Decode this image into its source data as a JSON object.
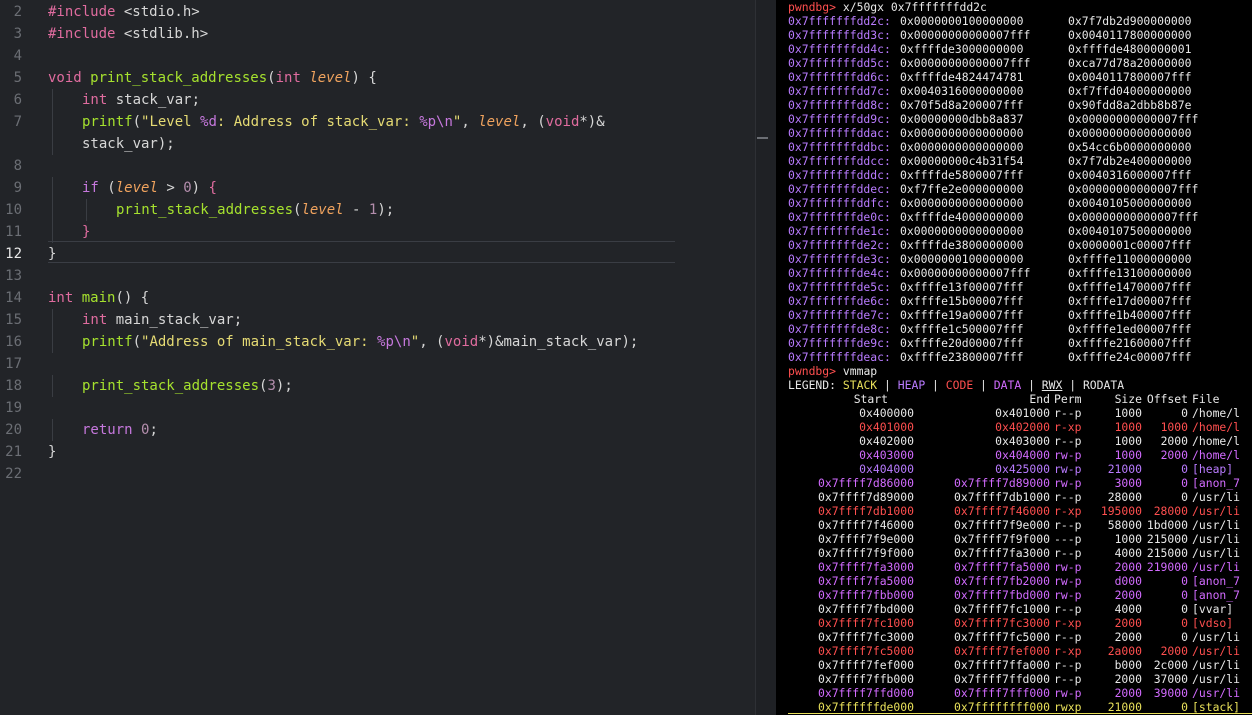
{
  "editor": {
    "lines": [
      {
        "n": "2",
        "tokens": [
          [
            "kw-pp",
            "#include "
          ],
          [
            "hdr",
            "<stdio.h>"
          ]
        ]
      },
      {
        "n": "3",
        "tokens": [
          [
            "kw-pp",
            "#include "
          ],
          [
            "hdr",
            "<stdlib.h>"
          ]
        ]
      },
      {
        "n": "4",
        "tokens": []
      },
      {
        "n": "5",
        "tokens": [
          [
            "typ",
            "void "
          ],
          [
            "fn",
            "print_stack_addresses"
          ],
          [
            "punc",
            "("
          ],
          [
            "typ",
            "int "
          ],
          [
            "param",
            "level"
          ],
          [
            "punc",
            ") {"
          ]
        ]
      },
      {
        "n": "6",
        "indent": 1,
        "tokens": [
          [
            "typ",
            "int "
          ],
          [
            "punc",
            "stack_var;"
          ]
        ]
      },
      {
        "n": "7",
        "indent": 1,
        "tokens": [
          [
            "fn",
            "printf"
          ],
          [
            "punc",
            "("
          ],
          [
            "str",
            "\"Level "
          ],
          [
            "esc",
            "%d"
          ],
          [
            "str",
            ": Address of stack_var: "
          ],
          [
            "esc",
            "%p\\n"
          ],
          [
            "str",
            "\""
          ],
          [
            "punc",
            ", "
          ],
          [
            "param",
            "level"
          ],
          [
            "punc",
            ", ("
          ],
          [
            "typ",
            "void"
          ],
          [
            "punc",
            "*)&"
          ]
        ]
      },
      {
        "n": "",
        "indent": 1,
        "tokens": [
          [
            "punc",
            "stack_var);"
          ]
        ]
      },
      {
        "n": "8",
        "tokens": []
      },
      {
        "n": "9",
        "indent": 1,
        "tokens": [
          [
            "kw",
            "if "
          ],
          [
            "punc",
            "("
          ],
          [
            "param",
            "level"
          ],
          [
            "punc",
            " > "
          ],
          [
            "num",
            "0"
          ],
          [
            "punc",
            ") "
          ],
          [
            "kw-pp",
            "{"
          ]
        ]
      },
      {
        "n": "10",
        "indent": 2,
        "tokens": [
          [
            "fn",
            "print_stack_addresses"
          ],
          [
            "punc",
            "("
          ],
          [
            "param",
            "level"
          ],
          [
            "punc",
            " - "
          ],
          [
            "num",
            "1"
          ],
          [
            "punc",
            ");"
          ]
        ]
      },
      {
        "n": "11",
        "indent": 1,
        "tokens": [
          [
            "kw-pp",
            "}"
          ]
        ]
      },
      {
        "n": "12",
        "active": true,
        "tokens": [
          [
            "punc",
            "}"
          ]
        ]
      },
      {
        "n": "13",
        "tokens": []
      },
      {
        "n": "14",
        "tokens": [
          [
            "typ",
            "int "
          ],
          [
            "fn",
            "main"
          ],
          [
            "punc",
            "() {"
          ]
        ]
      },
      {
        "n": "15",
        "indent": 1,
        "tokens": [
          [
            "typ",
            "int "
          ],
          [
            "punc",
            "main_stack_var;"
          ]
        ]
      },
      {
        "n": "16",
        "indent": 1,
        "tokens": [
          [
            "fn",
            "printf"
          ],
          [
            "punc",
            "("
          ],
          [
            "str",
            "\"Address of main_stack_var: "
          ],
          [
            "esc",
            "%p\\n"
          ],
          [
            "str",
            "\""
          ],
          [
            "punc",
            ", ("
          ],
          [
            "typ",
            "void"
          ],
          [
            "punc",
            "*)&main_stack_var);"
          ]
        ]
      },
      {
        "n": "17",
        "tokens": []
      },
      {
        "n": "18",
        "indent": 1,
        "tokens": [
          [
            "fn",
            "print_stack_addresses"
          ],
          [
            "punc",
            "("
          ],
          [
            "num",
            "3"
          ],
          [
            "punc",
            ");"
          ]
        ]
      },
      {
        "n": "19",
        "tokens": []
      },
      {
        "n": "20",
        "indent": 1,
        "tokens": [
          [
            "kw",
            "return "
          ],
          [
            "num",
            "0"
          ],
          [
            "punc",
            ";"
          ]
        ]
      },
      {
        "n": "21",
        "tokens": [
          [
            "punc",
            "}"
          ]
        ]
      },
      {
        "n": "22",
        "tokens": []
      }
    ]
  },
  "terminal": {
    "cmd1_prompt": "pwndbg>",
    "cmd1": " x/50gx 0x7fffffffdd2c",
    "dump": [
      [
        "0x7fffffffdd2c:",
        "0x0000000100000000",
        "0x7f7db2d900000000"
      ],
      [
        "0x7fffffffdd3c:",
        "0x00000000000007fff",
        "0x0040117800000000"
      ],
      [
        "0x7fffffffdd4c:",
        "0xffffde3000000000",
        "0xffffde4800000001"
      ],
      [
        "0x7fffffffdd5c:",
        "0x00000000000007fff",
        "0xca77d78a20000000"
      ],
      [
        "0x7fffffffdd6c:",
        "0xffffde4824474781",
        "0x0040117800007fff"
      ],
      [
        "0x7fffffffdd7c:",
        "0x0040316000000000",
        "0xf7ffd04000000000"
      ],
      [
        "0x7fffffffdd8c:",
        "0x70f5d8a200007fff",
        "0x90fdd8a2dbb8b87e"
      ],
      [
        "0x7fffffffdd9c:",
        "0x00000000dbb8a837",
        "0x00000000000007fff"
      ],
      [
        "0x7fffffffddac:",
        "0x0000000000000000",
        "0x0000000000000000"
      ],
      [
        "0x7fffffffddbc:",
        "0x0000000000000000",
        "0x54cc6b0000000000"
      ],
      [
        "0x7fffffffddcc:",
        "0x00000000c4b31f54",
        "0x7f7db2e400000000"
      ],
      [
        "0x7fffffffdddc:",
        "0xffffde5800007fff",
        "0x0040316000007fff"
      ],
      [
        "0x7fffffffddec:",
        "0xf7ffe2e000000000",
        "0x00000000000007fff"
      ],
      [
        "0x7fffffffddfc:",
        "0x0000000000000000",
        "0x0040105000000000"
      ],
      [
        "0x7fffffffde0c:",
        "0xffffde4000000000",
        "0x00000000000007fff"
      ],
      [
        "0x7fffffffde1c:",
        "0x0000000000000000",
        "0x0040107500000000"
      ],
      [
        "0x7fffffffde2c:",
        "0xffffde3800000000",
        "0x0000001c00007fff"
      ],
      [
        "0x7fffffffde3c:",
        "0x0000000100000000",
        "0xffffe11000000000"
      ],
      [
        "0x7fffffffde4c:",
        "0x00000000000007fff",
        "0xffffe13100000000"
      ],
      [
        "0x7fffffffde5c:",
        "0xffffe13f00007fff",
        "0xffffe14700007fff"
      ],
      [
        "0x7fffffffde6c:",
        "0xffffe15b00007fff",
        "0xffffe17d00007fff"
      ],
      [
        "0x7fffffffde7c:",
        "0xffffe19a00007fff",
        "0xffffe1b400007fff"
      ],
      [
        "0x7fffffffde8c:",
        "0xffffe1c500007fff",
        "0xffffe1ed00007fff"
      ],
      [
        "0x7fffffffde9c:",
        "0xffffe20d00007fff",
        "0xffffe21600007fff"
      ],
      [
        "0x7fffffffdeac:",
        "0xffffe23800007fff",
        "0xffffe24c00007fff"
      ]
    ],
    "cmd2_prompt": "pwndbg>",
    "cmd2": " vmmap",
    "legend_label": "LEGEND: ",
    "legend": [
      [
        "c-stack",
        "STACK"
      ],
      [
        "c-white",
        " | "
      ],
      [
        "c-heap",
        "HEAP"
      ],
      [
        "c-white",
        " | "
      ],
      [
        "c-code",
        "CODE"
      ],
      [
        "c-white",
        " | "
      ],
      [
        "c-data",
        "DATA"
      ],
      [
        "c-white",
        " | "
      ],
      [
        "c-rwx",
        "RWX"
      ],
      [
        "c-white",
        " | RODATA"
      ]
    ],
    "vm_header": [
      "Start",
      "End",
      "Perm",
      "Size",
      "Offset",
      "File"
    ],
    "vmmap": [
      [
        "row-ro",
        "0x400000",
        "0x401000",
        "r--p",
        "1000",
        "0",
        "/home/l"
      ],
      [
        "row-code",
        "0x401000",
        "0x402000",
        "r-xp",
        "1000",
        "1000",
        "/home/l"
      ],
      [
        "row-ro",
        "0x402000",
        "0x403000",
        "r--p",
        "1000",
        "2000",
        "/home/l"
      ],
      [
        "row-data",
        "0x403000",
        "0x404000",
        "rw-p",
        "1000",
        "2000",
        "/home/l"
      ],
      [
        "row-heap",
        "0x404000",
        "0x425000",
        "rw-p",
        "21000",
        "0",
        "[heap]"
      ],
      [
        "row-data",
        "0x7ffff7d86000",
        "0x7ffff7d89000",
        "rw-p",
        "3000",
        "0",
        "[anon_7"
      ],
      [
        "row-ro",
        "0x7ffff7d89000",
        "0x7ffff7db1000",
        "r--p",
        "28000",
        "0",
        "/usr/li"
      ],
      [
        "row-code",
        "0x7ffff7db1000",
        "0x7ffff7f46000",
        "r-xp",
        "195000",
        "28000",
        "/usr/li"
      ],
      [
        "row-ro",
        "0x7ffff7f46000",
        "0x7ffff7f9e000",
        "r--p",
        "58000",
        "1bd000",
        "/usr/li"
      ],
      [
        "row-ro",
        "0x7ffff7f9e000",
        "0x7ffff7f9f000",
        "---p",
        "1000",
        "215000",
        "/usr/li"
      ],
      [
        "row-ro",
        "0x7ffff7f9f000",
        "0x7ffff7fa3000",
        "r--p",
        "4000",
        "215000",
        "/usr/li"
      ],
      [
        "row-data",
        "0x7ffff7fa3000",
        "0x7ffff7fa5000",
        "rw-p",
        "2000",
        "219000",
        "/usr/li"
      ],
      [
        "row-data",
        "0x7ffff7fa5000",
        "0x7ffff7fb2000",
        "rw-p",
        "d000",
        "0",
        "[anon_7"
      ],
      [
        "row-data",
        "0x7ffff7fbb000",
        "0x7ffff7fbd000",
        "rw-p",
        "2000",
        "0",
        "[anon_7"
      ],
      [
        "row-ro",
        "0x7ffff7fbd000",
        "0x7ffff7fc1000",
        "r--p",
        "4000",
        "0",
        "[vvar]"
      ],
      [
        "row-code",
        "0x7ffff7fc1000",
        "0x7ffff7fc3000",
        "r-xp",
        "2000",
        "0",
        "[vdso]"
      ],
      [
        "row-ro",
        "0x7ffff7fc3000",
        "0x7ffff7fc5000",
        "r--p",
        "2000",
        "0",
        "/usr/li"
      ],
      [
        "row-code",
        "0x7ffff7fc5000",
        "0x7ffff7fef000",
        "r-xp",
        "2a000",
        "2000",
        "/usr/li"
      ],
      [
        "row-ro",
        "0x7ffff7fef000",
        "0x7ffff7ffa000",
        "r--p",
        "b000",
        "2c000",
        "/usr/li"
      ],
      [
        "row-ro",
        "0x7ffff7ffb000",
        "0x7ffff7ffd000",
        "r--p",
        "2000",
        "37000",
        "/usr/li"
      ],
      [
        "row-data",
        "0x7ffff7ffd000",
        "0x7ffff7fff000",
        "rw-p",
        "2000",
        "39000",
        "/usr/li"
      ],
      [
        "row-stack",
        "0x7ffffffde000",
        "0x7ffffffff000",
        "rwxp",
        "21000",
        "0",
        "[stack]"
      ]
    ]
  }
}
